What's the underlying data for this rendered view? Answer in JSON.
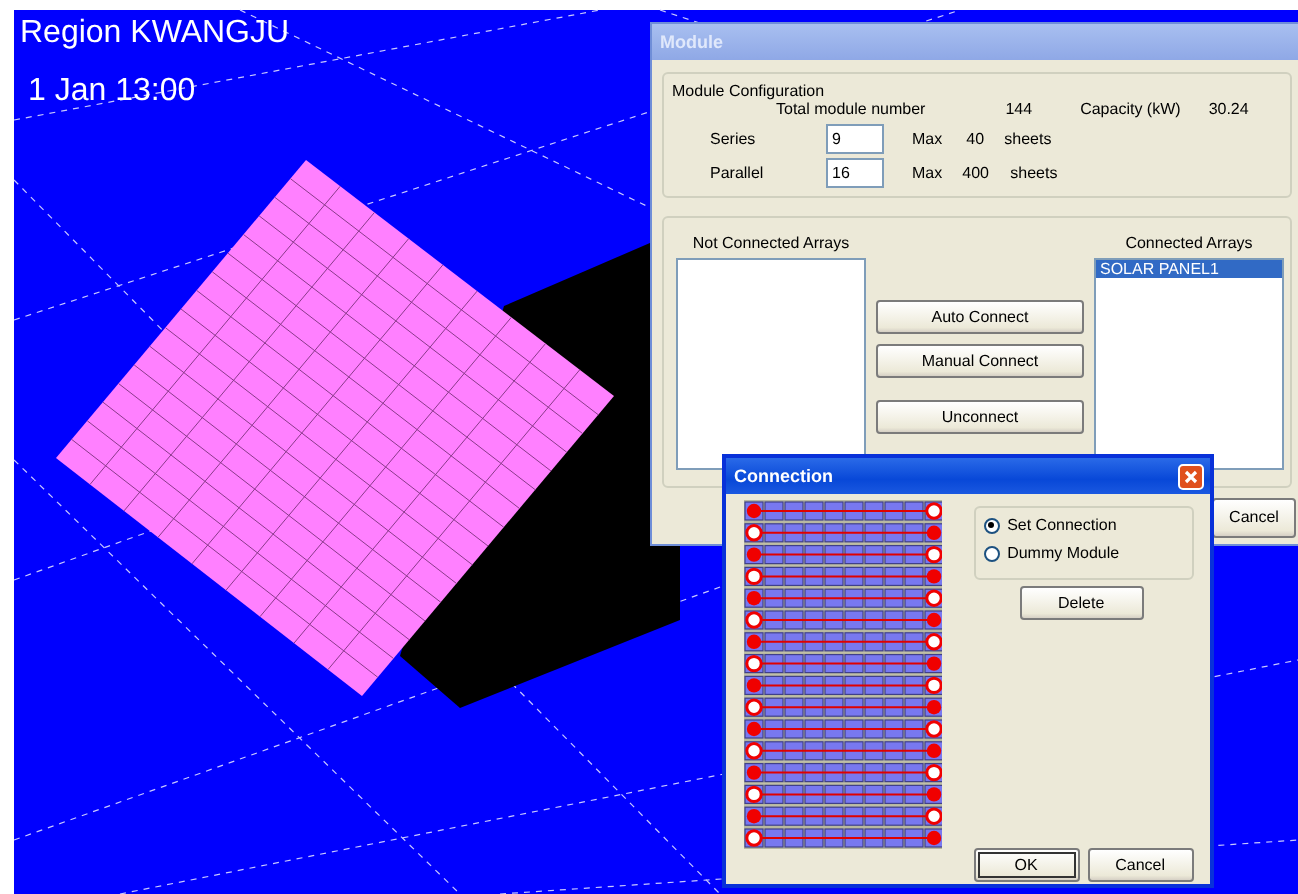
{
  "scene": {
    "region_label": "Region KWANGJU",
    "time_label": "1 Jan 13:00"
  },
  "module_window": {
    "title": "Module",
    "active": false,
    "config_group": {
      "label": "Module Configuration",
      "total_label": "Total module number",
      "total_value": "144",
      "capacity_label": "Capacity (kW)",
      "capacity_value": "30.24",
      "fields": [
        {
          "label": "Series",
          "value": "9",
          "max_label": "Max",
          "max_value": "40",
          "unit": "sheets"
        },
        {
          "label": "Parallel",
          "value": "16",
          "max_label": "Max",
          "max_value": "400",
          "unit": "sheets"
        }
      ]
    },
    "arrays_group": {
      "not_connected_label": "Not Connected Arrays",
      "connected_label": "Connected Arrays",
      "connected_items": [
        {
          "text": "SOLAR PANEL1",
          "selected": true
        }
      ],
      "buttons": [
        "Auto Connect",
        "Manual Connect",
        "Unconnect"
      ]
    },
    "footer_buttons": [
      "Cancel"
    ]
  },
  "connection_dialog": {
    "title": "Connection",
    "active": true,
    "rows": [
      {
        "left_filled": true
      },
      {
        "left_filled": false
      },
      {
        "left_filled": true
      },
      {
        "left_filled": false
      },
      {
        "left_filled": true
      },
      {
        "left_filled": false
      },
      {
        "left_filled": true
      },
      {
        "left_filled": false
      },
      {
        "left_filled": true
      },
      {
        "left_filled": false
      },
      {
        "left_filled": true
      },
      {
        "left_filled": false
      },
      {
        "left_filled": true
      },
      {
        "left_filled": false
      },
      {
        "left_filled": true
      },
      {
        "left_filled": false
      }
    ],
    "options": [
      {
        "label": "Set Connection",
        "selected": true
      },
      {
        "label": "Dummy Module",
        "selected": false
      }
    ],
    "delete_button": "Delete",
    "buttons": [
      {
        "label": "OK",
        "default": true
      },
      {
        "label": "Cancel",
        "default": false
      }
    ]
  }
}
